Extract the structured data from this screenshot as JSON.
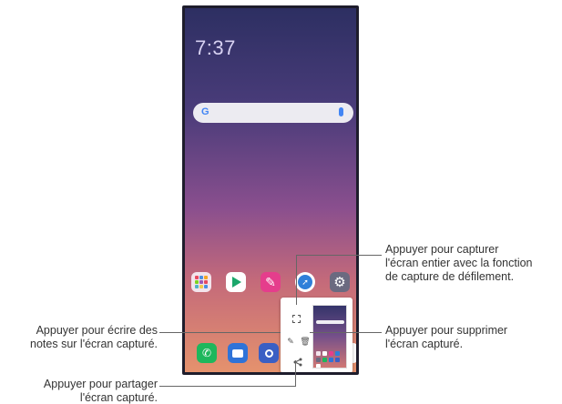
{
  "lockscreen": {
    "time": "7:37",
    "date": "",
    "weather": ""
  },
  "search": {
    "placeholder": ""
  },
  "apps": [
    "",
    "",
    "",
    "",
    ""
  ],
  "dock": [
    "",
    "",
    "",
    ""
  ],
  "callouts": {
    "capture": [
      "Appuyer pour capturer",
      "l'écran entier avec la fonction",
      "de capture de défilement."
    ],
    "edit": [
      "Appuyer pour écrire des",
      "notes sur l'écran capturé."
    ],
    "delete": [
      "Appuyer pour supprimer",
      "l'écran capturé."
    ],
    "share": [
      "Appuyer pour partager",
      "l'écran capturé."
    ]
  },
  "icons": {
    "capture": "scroll-capture-icon",
    "edit": "edit-pen-icon",
    "delete": "trash-icon",
    "share": "share-icon"
  },
  "colors": {
    "wallpaper_top": "#2d2f62",
    "wallpaper_bottom": "#e5926d",
    "phone_frame": "#1e1d2c",
    "leader_line": "#666666"
  }
}
